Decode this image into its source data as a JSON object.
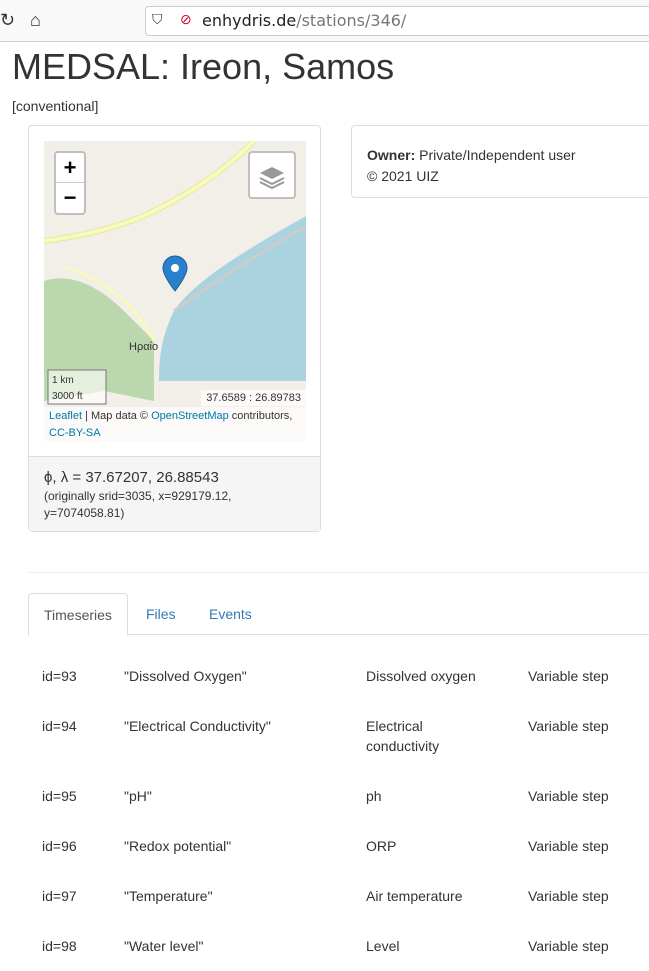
{
  "browser": {
    "url_domain": "enhydris.de",
    "url_path": "/stations/346/"
  },
  "station": {
    "title": "MEDSAL: Ireon, Samos",
    "type": "[conventional]"
  },
  "map": {
    "zoom_in": "+",
    "zoom_out": "−",
    "mouse_position": "37.6589 : 26.89783",
    "attribution_leaflet": "Leaflet",
    "attribution_text": " | Map data © ",
    "attribution_osm": "OpenStreetMap",
    "attribution_contrib": " contributors, ",
    "attribution_license": "CC-BY-SA",
    "scale_km": "1 km",
    "scale_ft": "3000 ft",
    "place_label": "Ηραίο",
    "colors": {
      "sea": "#aad3df",
      "land": "#f2efe9",
      "forest": "#add19e",
      "road": "#f7fabf",
      "marker": "#2a81cb"
    }
  },
  "location": {
    "coords": "ϕ, λ = 37.67207, 26.88543",
    "original": "(originally srid=3035, x=929179.12, y=7074058.81)"
  },
  "owner": {
    "label": "Owner:",
    "value": "Private/Independent user",
    "copyright": "© 2021 UIZ"
  },
  "tabs": [
    {
      "label": "Timeseries",
      "active": true
    },
    {
      "label": "Files"
    },
    {
      "label": "Events"
    }
  ],
  "timeseries": [
    {
      "id": "id=93",
      "name": "\"Dissolved Oxygen\"",
      "variable": "Dissolved oxygen",
      "step": "Variable step"
    },
    {
      "id": "id=94",
      "name": "\"Electrical Conductivity\"",
      "variable": "Electrical conductivity",
      "step": "Variable step"
    },
    {
      "id": "id=95",
      "name": "\"pH\"",
      "variable": "ph",
      "step": "Variable step"
    },
    {
      "id": "id=96",
      "name": "\"Redox potential\"",
      "variable": "ORP",
      "step": "Variable step"
    },
    {
      "id": "id=97",
      "name": "\"Temperature\"",
      "variable": "Air temperature",
      "step": "Variable step"
    },
    {
      "id": "id=98",
      "name": "\"Water level\"",
      "variable": "Level",
      "step": "Variable step"
    }
  ]
}
